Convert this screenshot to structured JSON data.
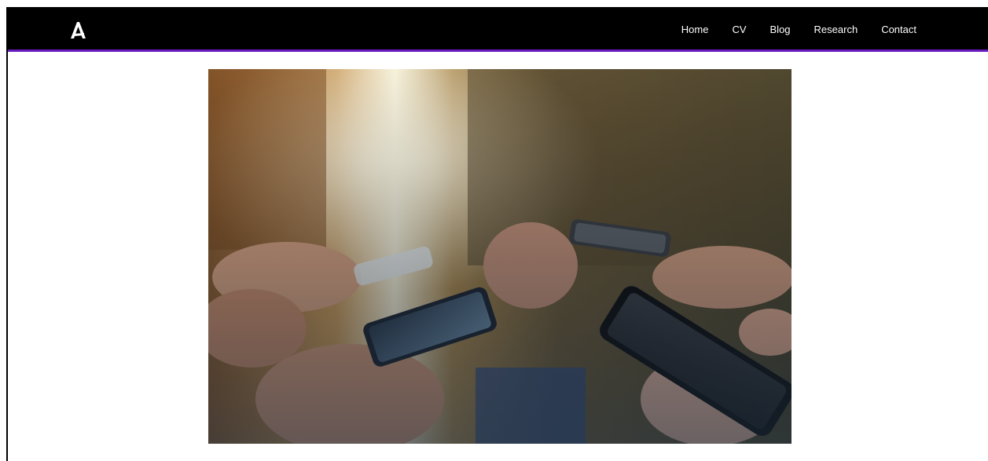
{
  "header": {
    "logo_icon": "letter-a-logo-icon",
    "accent_color": "#6a1bbf",
    "nav": [
      {
        "label": "Home"
      },
      {
        "label": "CV"
      },
      {
        "label": "Blog"
      },
      {
        "label": "Research"
      },
      {
        "label": "Contact"
      }
    ]
  },
  "main": {
    "hero_image": "hands-holding-smartphones-photo"
  }
}
